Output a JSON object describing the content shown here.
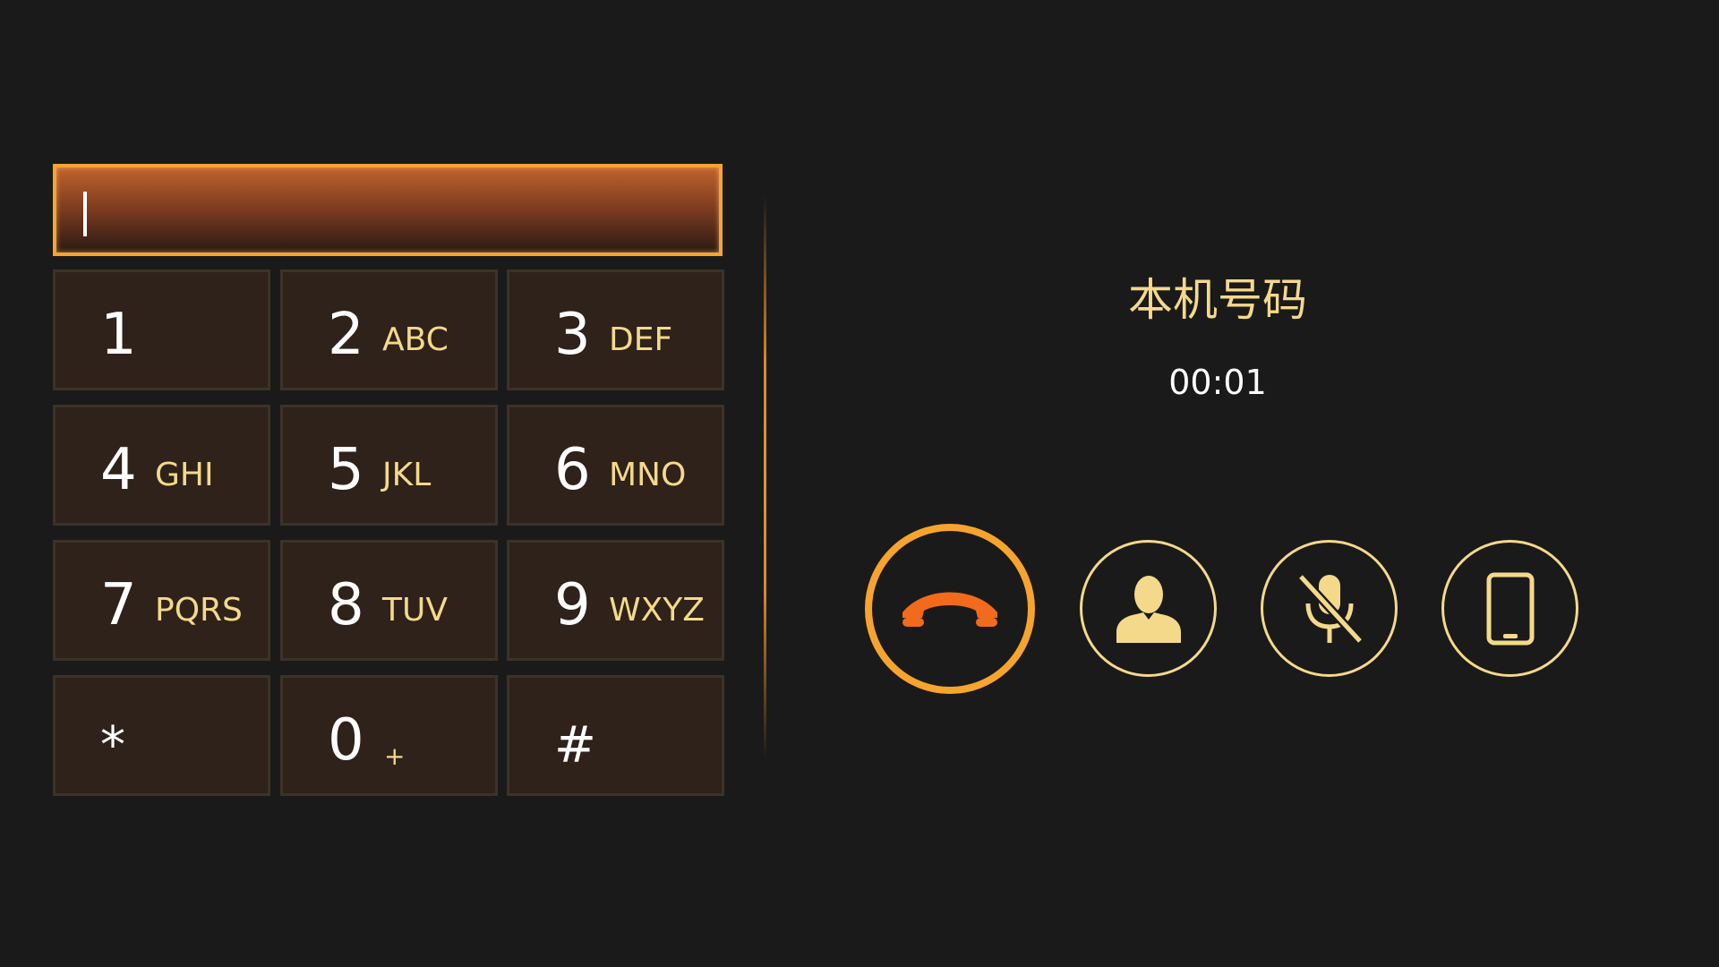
{
  "number_field": {
    "value": ""
  },
  "keypad": {
    "keys": [
      {
        "digit": "1",
        "letters": ""
      },
      {
        "digit": "2",
        "letters": "ABC"
      },
      {
        "digit": "3",
        "letters": "DEF"
      },
      {
        "digit": "4",
        "letters": "GHI"
      },
      {
        "digit": "5",
        "letters": "JKL"
      },
      {
        "digit": "6",
        "letters": "MNO"
      },
      {
        "digit": "7",
        "letters": "PQRS"
      },
      {
        "digit": "8",
        "letters": "TUV"
      },
      {
        "digit": "9",
        "letters": "WXYZ"
      },
      {
        "digit": "*",
        "letters": ""
      },
      {
        "digit": "0",
        "letters": "+"
      },
      {
        "digit": "#",
        "letters": ""
      }
    ]
  },
  "call": {
    "caller_name": "本机号码",
    "timer": "00:01"
  },
  "actions": {
    "end_call_icon": "hang-up-icon",
    "contact_icon": "contact-icon",
    "mute_icon": "microphone-muted-icon",
    "device_icon": "phone-device-icon"
  },
  "colors": {
    "accent": "#f7a42f",
    "hangup": "#f26a1b",
    "label": "#f5d98a",
    "key_bg": "#2e221a",
    "background": "#1a1a1a"
  }
}
